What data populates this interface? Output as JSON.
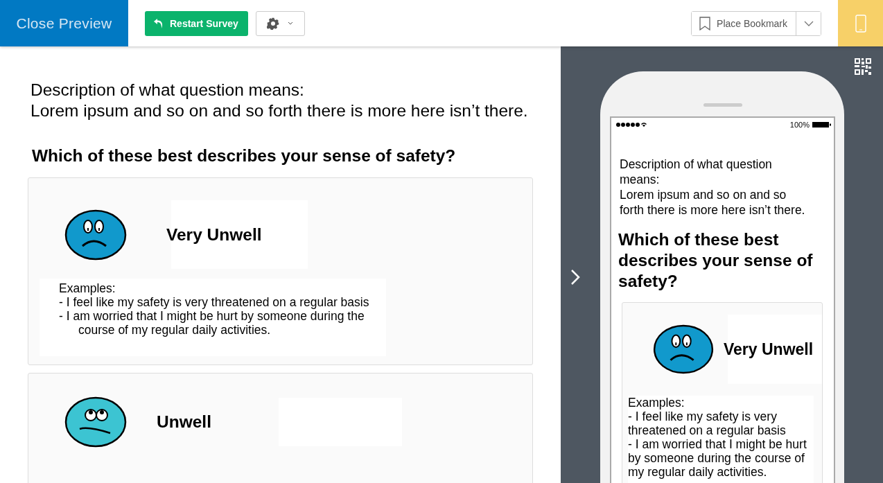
{
  "toolbar": {
    "close_preview": "Close Preview",
    "restart": "Restart Survey",
    "bookmark": "Place Bookmark",
    "mobile_preview": {
      "on": true
    }
  },
  "survey": {
    "description": [
      "Description of what question means:",
      "Lorem ipsum and so on and so forth there is more here isn’t there."
    ],
    "question": "Which of these best describes your sense of safety?",
    "options": [
      {
        "label": "Very Unwell",
        "kind": "sad",
        "color": "#1199cc",
        "examples_title": "Examples:",
        "examples": [
          "- I feel like my safety is very threatened on a regular basis",
          "- I am worried that I might be hurt by someone during the course of my regular daily activities."
        ]
      },
      {
        "label": "Unwell",
        "kind": "worried",
        "color": "#3cc4d2"
      }
    ]
  },
  "phone_preview": {
    "battery": "100%",
    "description": [
      "Description of what question means:",
      "Lorem ipsum and so on and so forth there is more here isn’t there."
    ],
    "question": "Which of these best describes your sense of safety?",
    "options": [
      {
        "label": "Very Unwell",
        "kind": "sad",
        "color": "#1199cc",
        "examples_title": "Examples:",
        "examples": [
          "- I feel like my safety is very threatened on a regular basis",
          "- I am worried that I might be hurt by someone during the course of my regular daily activities."
        ]
      }
    ]
  }
}
